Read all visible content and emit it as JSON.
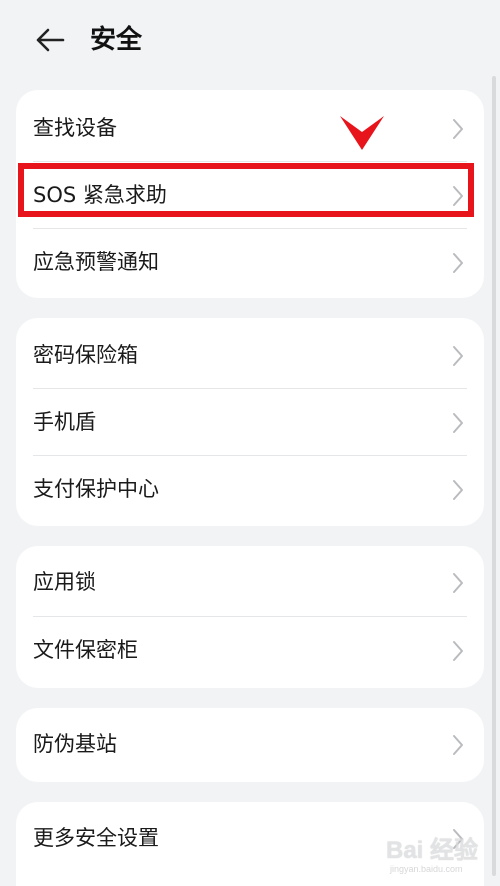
{
  "header": {
    "title": "安全",
    "back_icon": "arrow-left-icon"
  },
  "groups": [
    {
      "items": [
        {
          "label": "查找设备"
        },
        {
          "label": "SOS 紧急求助",
          "highlighted": true
        },
        {
          "label": "应急预警通知"
        }
      ]
    },
    {
      "items": [
        {
          "label": "密码保险箱"
        },
        {
          "label": "手机盾"
        },
        {
          "label": "支付保护中心"
        }
      ]
    },
    {
      "items": [
        {
          "label": "应用锁"
        },
        {
          "label": "文件保密柜"
        }
      ]
    },
    {
      "items": [
        {
          "label": "防伪基站"
        }
      ]
    },
    {
      "items": [
        {
          "label": "更多安全设置"
        }
      ]
    }
  ],
  "annotation": {
    "highlight_color": "#e8141c",
    "arrow_icon": "chevron-down-marker-icon"
  },
  "watermark": {
    "main": "Bai 经验",
    "sub": "jingyan.baidu.com"
  },
  "colors": {
    "background": "#f1f3f5",
    "card": "#ffffff",
    "text": "#1a1a1a",
    "chevron": "#b9bbbe"
  }
}
